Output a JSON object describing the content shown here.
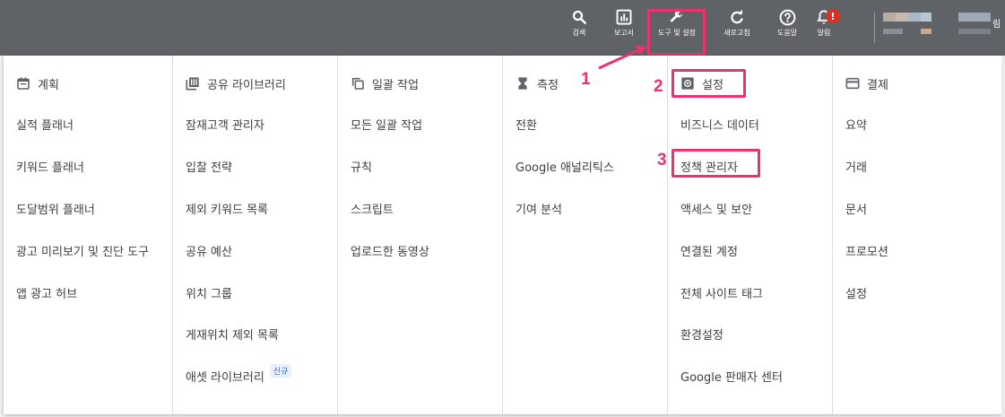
{
  "topbar": {
    "buttons": [
      {
        "id": "search",
        "label": "검색",
        "icon": "search-icon"
      },
      {
        "id": "reports",
        "label": "보고서",
        "icon": "bar-chart-icon"
      },
      {
        "id": "tools",
        "label": "도구 및 설정",
        "icon": "wrench-icon"
      },
      {
        "id": "refresh",
        "label": "새로고침",
        "icon": "refresh-icon"
      },
      {
        "id": "help",
        "label": "도움말",
        "icon": "help-icon"
      },
      {
        "id": "notifications",
        "label": "알림",
        "icon": "bell-icon",
        "badge": "!"
      }
    ],
    "account_initial": "림"
  },
  "annotations": {
    "step1": "1",
    "step2": "2",
    "step3": "3"
  },
  "menu": {
    "columns": [
      {
        "id": "planning",
        "title": "계획",
        "icon": "calendar-icon",
        "items": [
          "실적 플래너",
          "키워드 플래너",
          "도달범위 플래너",
          "광고 미리보기 및 진단 도구",
          "앱 광고 허브"
        ]
      },
      {
        "id": "shared-library",
        "title": "공유 라이브러리",
        "icon": "library-icon",
        "items": [
          "잠재고객 관리자",
          "입찰 전략",
          "제외 키워드 목록",
          "공유 예산",
          "위치 그룹",
          "게재위치 제외 목록",
          "애셋 라이브러리"
        ],
        "new_tag": "신규"
      },
      {
        "id": "bulk-actions",
        "title": "일괄 작업",
        "icon": "copy-icon",
        "items": [
          "모든 일괄 작업",
          "규칙",
          "스크립트",
          "업로드한 동영상"
        ]
      },
      {
        "id": "measurement",
        "title": "측정",
        "icon": "hourglass-icon",
        "items": [
          "전환",
          "Google 애널리틱스",
          "기여 분석"
        ]
      },
      {
        "id": "setup",
        "title": "설정",
        "icon": "settings-icon",
        "items": [
          "비즈니스 데이터",
          "정책 관리자",
          "액세스 및 보안",
          "연결된 계정",
          "전체 사이트 태그",
          "환경설정",
          "Google 판매자 센터"
        ]
      },
      {
        "id": "billing",
        "title": "결제",
        "icon": "credit-card-icon",
        "items": [
          "요약",
          "거래",
          "문서",
          "프로모션",
          "설정"
        ]
      }
    ]
  },
  "colors": {
    "topbar": "#5f6368",
    "highlight": "#e8336d",
    "text": "#3c4043",
    "divider": "#dadce0"
  }
}
